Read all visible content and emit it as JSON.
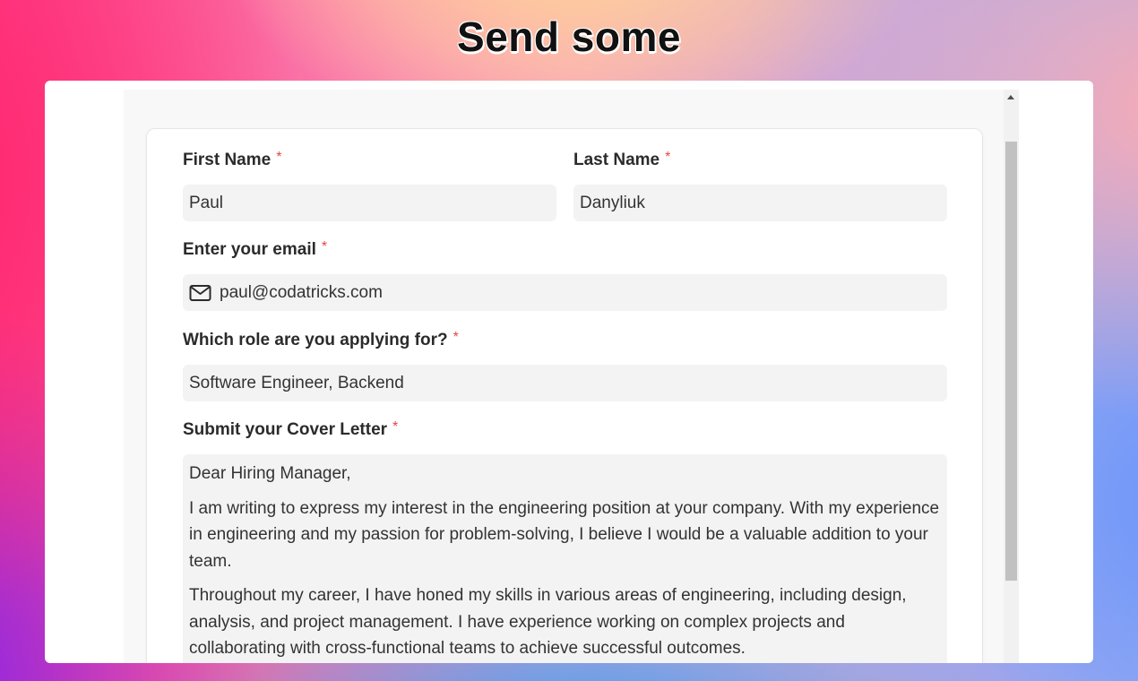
{
  "headline": "Send some",
  "form": {
    "first_name": {
      "label": "First Name",
      "required_mark": "*",
      "value": "Paul"
    },
    "last_name": {
      "label": "Last Name",
      "required_mark": "*",
      "value": "Danyliuk"
    },
    "email": {
      "label": "Enter your email",
      "required_mark": "*",
      "value": "paul@codatricks.com",
      "icon": "mail-icon"
    },
    "role": {
      "label": "Which role are you applying for?",
      "required_mark": "*",
      "value": "Software Engineer, Backend"
    },
    "cover_letter": {
      "label": "Submit your Cover Letter",
      "required_mark": "*",
      "paragraphs": [
        "Dear Hiring Manager,",
        "I am writing to express my interest in the engineering position at your company. With my experience in engineering and my passion for problem-solving, I believe I would be a valuable addition to your team.",
        "Throughout my career, I have honed my skills in various areas of engineering, including design, analysis, and project management. I have experience working on complex projects and collaborating with cross-functional teams to achieve successful outcomes."
      ]
    }
  },
  "colors": {
    "required": "#e04848",
    "field_bg": "#f3f3f3",
    "label_text": "#2b2b2b"
  }
}
